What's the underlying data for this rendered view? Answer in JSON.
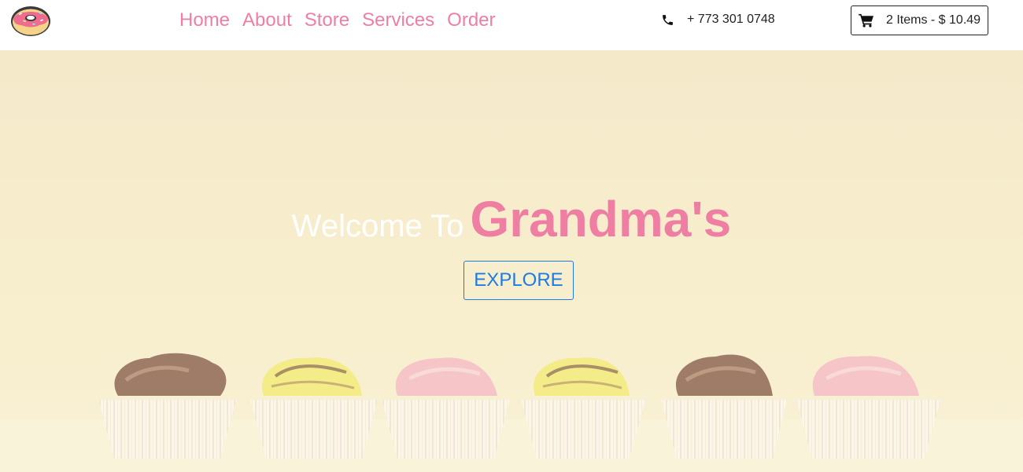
{
  "nav": {
    "logo_icon": "donut-icon",
    "links": [
      "Home",
      "About",
      "Store",
      "Services",
      "Order"
    ],
    "link_color": "#ee7fa3",
    "phone": {
      "icon": "phone-icon",
      "text": "+ 773 301 0748"
    },
    "cart": {
      "icon": "cart-icon",
      "text": "2 Items - $ 10.49"
    }
  },
  "hero": {
    "welcome": "Welcome To",
    "brand": "Grandma's",
    "brand_color": "#ee7fa3",
    "button": "EXPLORE",
    "button_color": "#1e7be6",
    "background": "cream wall with six frosted cupcakes"
  }
}
